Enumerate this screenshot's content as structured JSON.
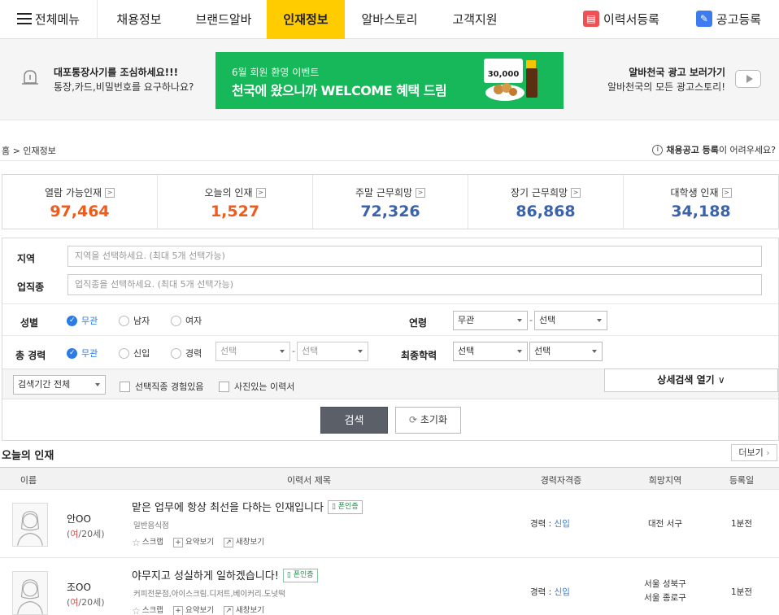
{
  "nav": {
    "all_menu": "전체메뉴",
    "items": [
      "채용정보",
      "브랜드알바",
      "인재정보",
      "알바스토리",
      "고객지원"
    ],
    "active_index": 2,
    "resume_register": "이력서등록",
    "job_register": "공고등록",
    "accent_color": "#ffcc00"
  },
  "banner": {
    "warning_title": "대포통장사기를 조심하세요!!!",
    "warning_text": "통장,카드,비밀번호를 요구하나요?",
    "promo_sub": "6월 회원 환영 이벤트",
    "promo_main": "천국에 왔으니까 WELCOME 혜택 드림",
    "coupon_value": "30,000",
    "ad_title": "알바천국 광고 보러가기",
    "ad_text": "알바천국의 모든 광고스토리!"
  },
  "breadcrumb": "홈 > 인재정보",
  "help": {
    "bold": "채용공고 등록",
    "rest": "이 어려우세요?"
  },
  "stats": [
    {
      "label": "열람 가능인재",
      "value": "97,464",
      "color": "#f05a1a"
    },
    {
      "label": "오늘의 인재",
      "value": "1,527",
      "color": "#f05a1a"
    },
    {
      "label": "주말 근무희망",
      "value": "72,326",
      "color": "#3a62ad"
    },
    {
      "label": "장기 근무희망",
      "value": "86,868",
      "color": "#3a62ad"
    },
    {
      "label": "대학생 인재",
      "value": "34,188",
      "color": "#3a62ad"
    }
  ],
  "search": {
    "region_label": "지역",
    "region_placeholder": "지역을 선택하세요. (최대 5개 선택가능)",
    "job_label": "업직종",
    "job_placeholder": "업직종을 선택하세요. (최대 5개 선택가능)",
    "gender_label": "성별",
    "gender_options": [
      "무관",
      "남자",
      "여자"
    ],
    "age_label": "연령",
    "age_from": "무관",
    "age_to": "선택",
    "career_label": "총 경력",
    "career_options": [
      "무관",
      "신입",
      "경력"
    ],
    "career_from": "선택",
    "career_to": "선택",
    "edu_label": "최종학력",
    "edu_from": "선택",
    "edu_to": "선택",
    "period": "검색기간 전체",
    "check1": "선택직종 경험있음",
    "check2": "사진있는 이력서",
    "detail_open": "상세검색 열기",
    "search_button": "검색",
    "reset_button": "초기화"
  },
  "today": {
    "title": "오늘의 인재",
    "more": "더보기",
    "headers": [
      "이름",
      "이력서 제목",
      "경력자격증",
      "희망지역",
      "등록일"
    ],
    "rows": [
      {
        "name": "안OO",
        "gender": "여",
        "age": "/20세)",
        "title": "맡은 업무에 항상 최선을 다하는 인재입니다",
        "badge": "폰인증",
        "sub": "일반음식점",
        "scrap": "스크랩",
        "summary": "요약보기",
        "newwin": "새창보기",
        "exp_label": "경력 : ",
        "exp_value": "신입",
        "region1": "대전 서구",
        "region2": "",
        "date": "1분전"
      },
      {
        "name": "조OO",
        "gender": "여",
        "age": "/20세)",
        "title": "야무지고 성실하게 일하겠습니다!",
        "badge": "폰인증",
        "sub": "커피전문점,아이스크림.디저트,베이커리.도넛떡",
        "scrap": "스크랩",
        "summary": "요약보기",
        "newwin": "새창보기",
        "exp_label": "경력 : ",
        "exp_value": "신입",
        "region1": "서울 성북구",
        "region2": "서울 종로구",
        "date": "1분전"
      }
    ]
  }
}
